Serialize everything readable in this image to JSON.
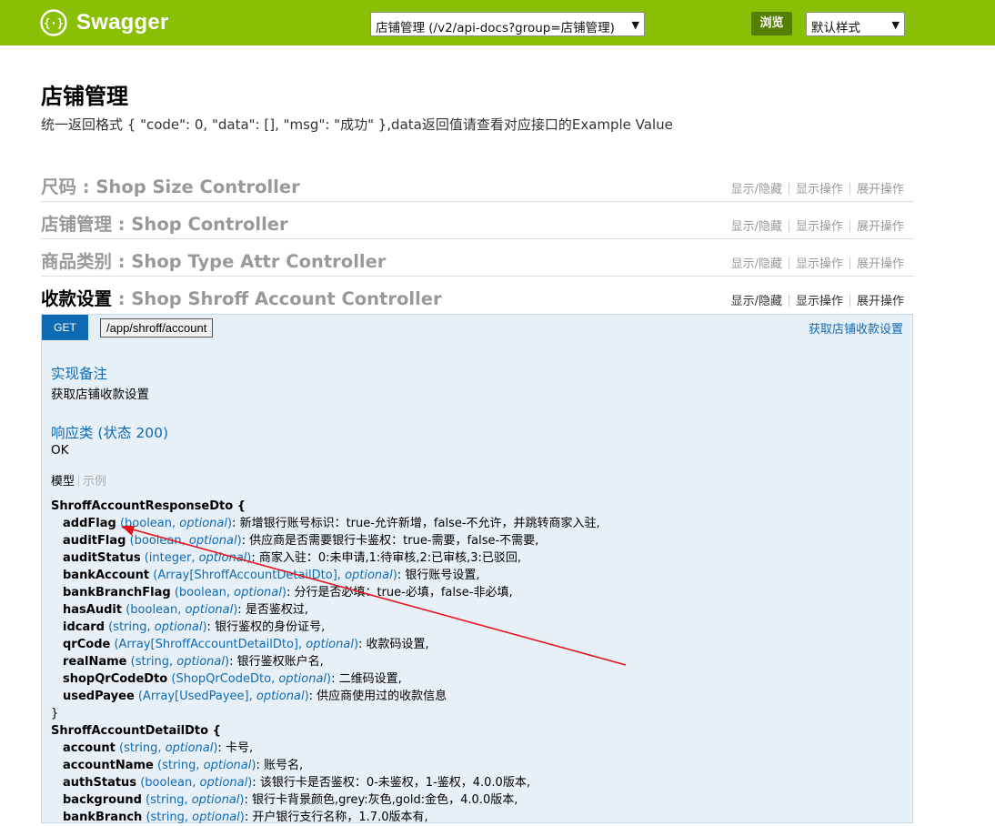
{
  "topbar": {
    "brand": "Swagger",
    "group_select": "店铺管理 (/v2/api-docs?group=店铺管理)",
    "explore_label": "浏览",
    "style_select": "默认样式",
    "color": "#89bf04"
  },
  "page": {
    "title": "店铺管理",
    "description": "统一返回格式 { \"code\": 0, \"data\": [], \"msg\": \"成功\" },data返回值请查看对应接口的Example Value"
  },
  "ops_labels": {
    "show_hide": "显示/隐藏",
    "list_ops": "显示操作",
    "expand_ops": "展开操作"
  },
  "resources": [
    {
      "zh": "尺码",
      "en": " : Shop Size Controller"
    },
    {
      "zh": "店铺管理",
      "en": " : Shop Controller"
    },
    {
      "zh": "商品类别",
      "en": " : Shop Type Attr Controller"
    },
    {
      "zh": "收款设置",
      "en": " : Shop Shroff Account Controller"
    }
  ],
  "operation": {
    "method": "GET",
    "path": "/app/shroff/account",
    "summary": "获取店铺收款设置",
    "notes_heading": "实现备注",
    "notes_text": "获取店铺收款设置",
    "response_heading": "响应类 (状态 200)",
    "response_text": "OK",
    "tab_model": "模型",
    "tab_example": "示例"
  },
  "models": [
    {
      "name": "ShroffAccountResponseDto {",
      "props": [
        {
          "name": "addFlag",
          "type": "boolean",
          "desc": "新增银行账号标识：true-允许新增，false-不允许，并跳转商家入驻,"
        },
        {
          "name": "auditFlag",
          "type": "boolean",
          "desc": "供应商是否需要银行卡鉴权：true-需要，false-不需要,"
        },
        {
          "name": "auditStatus",
          "type": "integer",
          "desc": "商家入驻：0:未申请,1:待审核,2:已审核,3:已驳回,"
        },
        {
          "name": "bankAccount",
          "type": "Array[ShroffAccountDetailDto]",
          "desc": "银行账号设置,"
        },
        {
          "name": "bankBranchFlag",
          "type": "boolean",
          "desc": "分行是否必填：true-必填，false-非必填,"
        },
        {
          "name": "hasAudit",
          "type": "boolean",
          "desc": "是否鉴权过,"
        },
        {
          "name": "idcard",
          "type": "string",
          "desc": "银行鉴权的身份证号,"
        },
        {
          "name": "qrCode",
          "type": "Array[ShroffAccountDetailDto]",
          "desc": "收款码设置,"
        },
        {
          "name": "realName",
          "type": "string",
          "desc": "银行鉴权账户名,"
        },
        {
          "name": "shopQrCodeDto",
          "type": "ShopQrCodeDto",
          "desc": "二维码设置,"
        },
        {
          "name": "usedPayee",
          "type": "Array[UsedPayee]",
          "desc": "供应商使用过的收款信息"
        }
      ],
      "close": "}"
    },
    {
      "name": "ShroffAccountDetailDto {",
      "props": [
        {
          "name": "account",
          "type": "string",
          "desc": "卡号,"
        },
        {
          "name": "accountName",
          "type": "string",
          "desc": "账号名,"
        },
        {
          "name": "authStatus",
          "type": "boolean",
          "desc": "该银行卡是否鉴权：0-未鉴权，1-鉴权，4.0.0版本,"
        },
        {
          "name": "background",
          "type": "string",
          "desc": "银行卡背景颜色,grey:灰色,gold:金色，4.0.0版本,"
        },
        {
          "name": "bankBranch",
          "type": "string",
          "desc": "开户银行支行名称，1.7.0版本有,"
        }
      ],
      "close": ""
    }
  ],
  "optional_label": "optional"
}
